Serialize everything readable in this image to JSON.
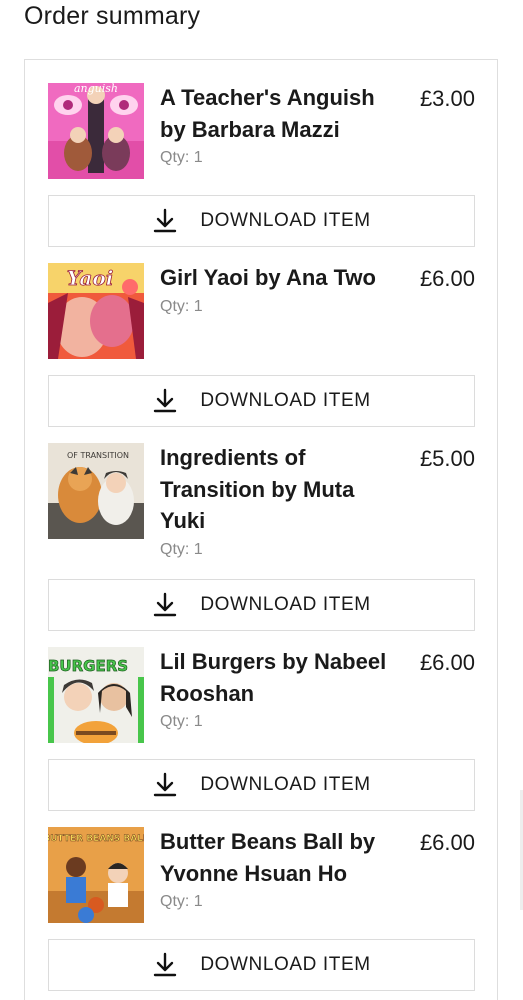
{
  "summary": {
    "title": "Order summary",
    "download_label": "DOWNLOAD ITEM",
    "items": [
      {
        "name": "A Teacher's Anguish by Barbara Mazzi",
        "price": "£3.00",
        "qty": "Qty: 1",
        "cover_text": "anguish",
        "cover_colors": [
          "#f06ac0",
          "#ffd3ee",
          "#3b2a3a"
        ]
      },
      {
        "name": "Girl Yaoi by Ana Two",
        "price": "£6.00",
        "qty": "Qty: 1",
        "cover_text": "Yaoi",
        "cover_colors": [
          "#f05a3c",
          "#f7d36a",
          "#9b1d3a"
        ]
      },
      {
        "name": "Ingredients of Transition by Muta Yuki",
        "price": "£5.00",
        "qty": "Qty: 1",
        "cover_text": "OF TRANSITION",
        "cover_colors": [
          "#e9e3d8",
          "#d98a3a",
          "#3d3a36"
        ]
      },
      {
        "name": "Lil Burgers by Nabeel Rooshan",
        "price": "£6.00",
        "qty": "Qty: 1",
        "cover_text": "BURGERS",
        "cover_colors": [
          "#48c64b",
          "#f0f0ea",
          "#f2a23a"
        ]
      },
      {
        "name": "Butter Beans Ball by Yvonne Hsuan Ho",
        "price": "£6.00",
        "qty": "Qty: 1",
        "cover_text": "BUTTER BEANS BALL",
        "cover_colors": [
          "#e8a048",
          "#3a7bd5",
          "#6b3b20"
        ]
      }
    ]
  }
}
